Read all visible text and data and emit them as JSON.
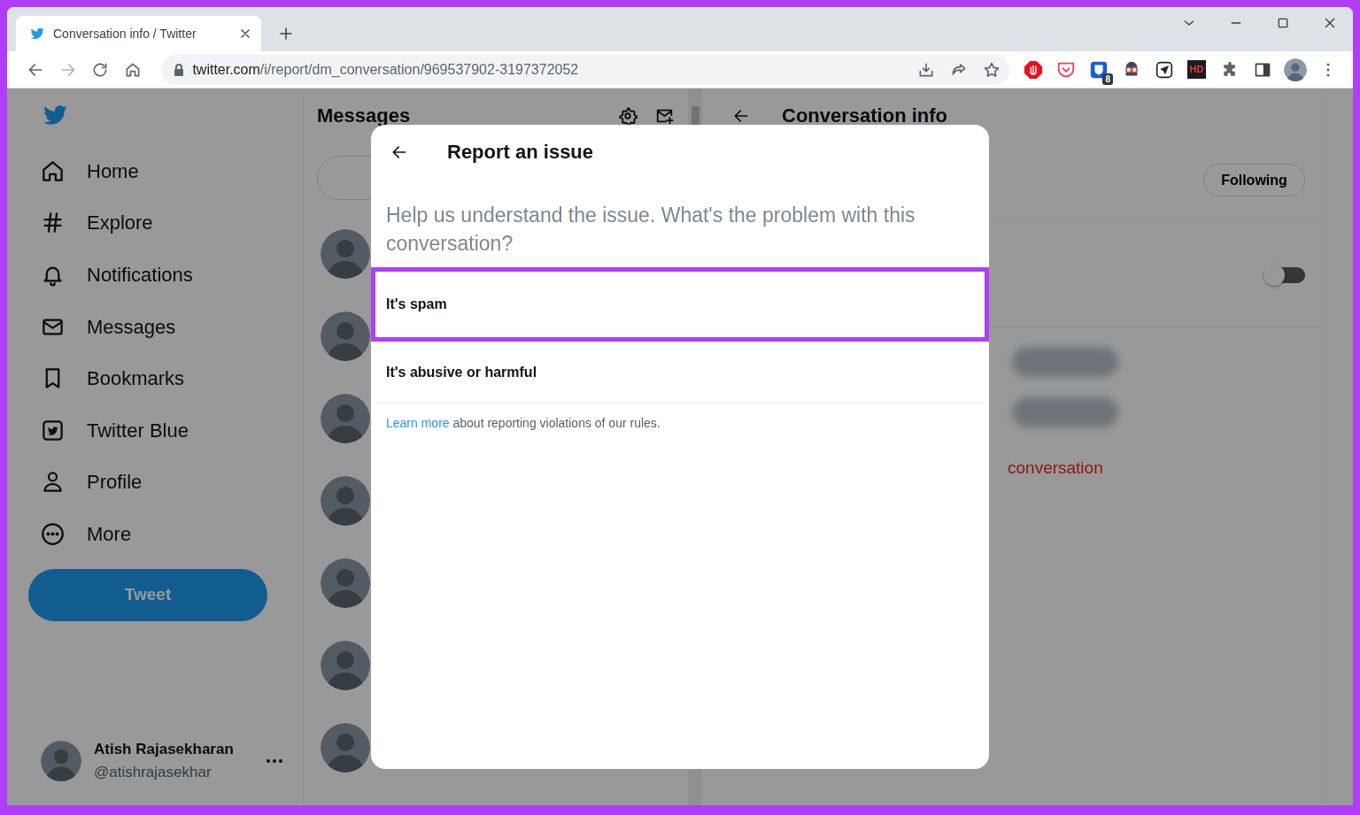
{
  "browser": {
    "tab": {
      "title": "Conversation info / Twitter"
    },
    "url": {
      "host": "twitter.com",
      "path": "/i/report/dm_conversation/969537902-3197372052"
    },
    "extension_badge": "8",
    "extension_label": "HD"
  },
  "sidebar": {
    "nav": [
      {
        "label": "Home"
      },
      {
        "label": "Explore"
      },
      {
        "label": "Notifications"
      },
      {
        "label": "Messages"
      },
      {
        "label": "Bookmarks"
      },
      {
        "label": "Twitter Blue"
      },
      {
        "label": "Profile"
      },
      {
        "label": "More"
      }
    ],
    "tweet_button": "Tweet",
    "account": {
      "name": "Atish Rajasekharan",
      "handle": "@atishrajasekhar"
    }
  },
  "messages": {
    "title": "Messages"
  },
  "conversation_info": {
    "title": "Conversation info",
    "follow_button": "Following",
    "toggle": {
      "on": false
    },
    "danger_text": "conversation"
  },
  "modal": {
    "title": "Report an issue",
    "prompt": "Help us understand the issue. What's the problem with this conversation?",
    "options": [
      {
        "label": "It's spam",
        "highlighted": true
      },
      {
        "label": "It's abusive or harmful",
        "highlighted": false
      }
    ],
    "footer": {
      "link": "Learn more",
      "text": " about reporting violations of our rules."
    }
  }
}
